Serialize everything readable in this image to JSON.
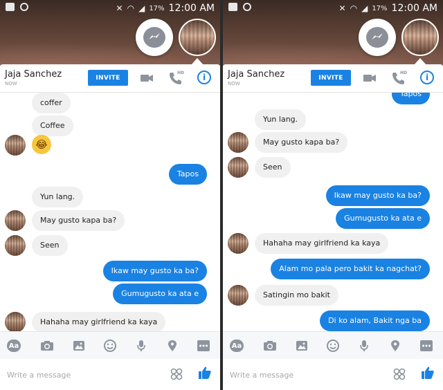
{
  "status_bar": {
    "battery": "17%",
    "time": "12:00 AM"
  },
  "header": {
    "contact_name": "Jaja Sanchez",
    "contact_status": "NOW",
    "invite_label": "INVITE",
    "hd_label": "HD"
  },
  "composer": {
    "placeholder": "Write a message"
  },
  "toolbar": {
    "aa_label": "Aa"
  },
  "colors": {
    "accent": "#1a82e2",
    "incoming_bubble": "#f1f0f0",
    "toolbar_bg": "#f6f7f9"
  },
  "icons": [
    "messenger-icon",
    "video-call-icon",
    "phone-hd-icon",
    "info-icon",
    "camera-icon",
    "gallery-icon",
    "emoji-icon",
    "microphone-icon",
    "location-icon",
    "more-icon",
    "qr-icon",
    "like-icon"
  ],
  "left_panel": {
    "messages": [
      {
        "dir": "in",
        "text": "coffer"
      },
      {
        "dir": "in",
        "text": "Coffee"
      },
      {
        "dir": "in",
        "text": "😂",
        "emoji": true
      },
      {
        "dir": "out",
        "text": "Tapos"
      },
      {
        "dir": "in",
        "text": "Yun lang."
      },
      {
        "dir": "in",
        "text": "May gusto kapa ba?"
      },
      {
        "dir": "in",
        "text": "Seen"
      },
      {
        "dir": "out",
        "text": "Ikaw may gusto ka ba?"
      },
      {
        "dir": "out",
        "text": "Gumugusto ka ata e"
      },
      {
        "dir": "in",
        "text": "Hahaha may girlfriend ka kaya"
      }
    ]
  },
  "right_panel": {
    "messages": [
      {
        "dir": "out",
        "text": "Tapos"
      },
      {
        "dir": "in",
        "text": "Yun lang."
      },
      {
        "dir": "in",
        "text": "May gusto kapa ba?"
      },
      {
        "dir": "in",
        "text": "Seen"
      },
      {
        "dir": "out",
        "text": "Ikaw may gusto ka ba?"
      },
      {
        "dir": "out",
        "text": "Gumugusto ka ata e"
      },
      {
        "dir": "in",
        "text": "Hahaha may girlfriend ka kaya"
      },
      {
        "dir": "out",
        "text": "Alam mo pala pero bakit ka nagchat?"
      },
      {
        "dir": "in",
        "text": "Satingin mo bakit"
      },
      {
        "dir": "out",
        "text": "Di ko alam, Bakit nga ba"
      }
    ]
  }
}
